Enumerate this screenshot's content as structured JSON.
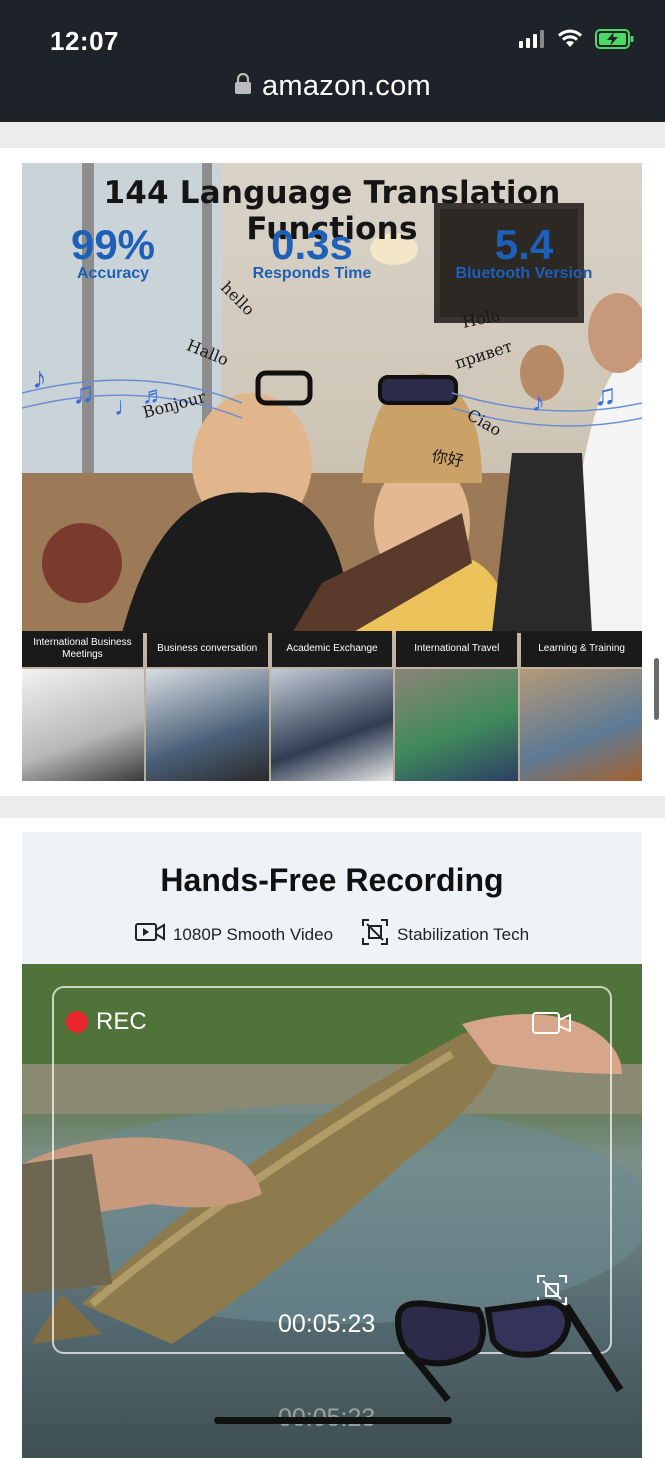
{
  "status_bar": {
    "time": "12:07"
  },
  "browser": {
    "url": "amazon.com"
  },
  "card1": {
    "headline": "144 Language Translation Functions",
    "stats": [
      {
        "value": "99%",
        "label": "Accuracy"
      },
      {
        "value": "0.3s",
        "label": "Responds Time"
      },
      {
        "value": "5.4",
        "label": "Bluetooth Version"
      }
    ],
    "words": [
      "hello",
      "Hallo",
      "Bonjour",
      "Hola",
      "привет",
      "Ciao",
      "你好"
    ],
    "tags": [
      "International Business Meetings",
      "Business conversation",
      "Academic Exchange",
      "International Travel",
      "Learning & Training"
    ]
  },
  "card2": {
    "title": "Hands-Free Recording",
    "features": [
      "1080P Smooth Video",
      "Stabilization Tech"
    ],
    "rec_label": "REC",
    "timecode": "00:05:23",
    "timecode_reflection": "00:05:23"
  },
  "colors": {
    "stat_blue": "#1e5fb8",
    "rec_red": "#e8262b",
    "status_bg": "#1e2329"
  }
}
